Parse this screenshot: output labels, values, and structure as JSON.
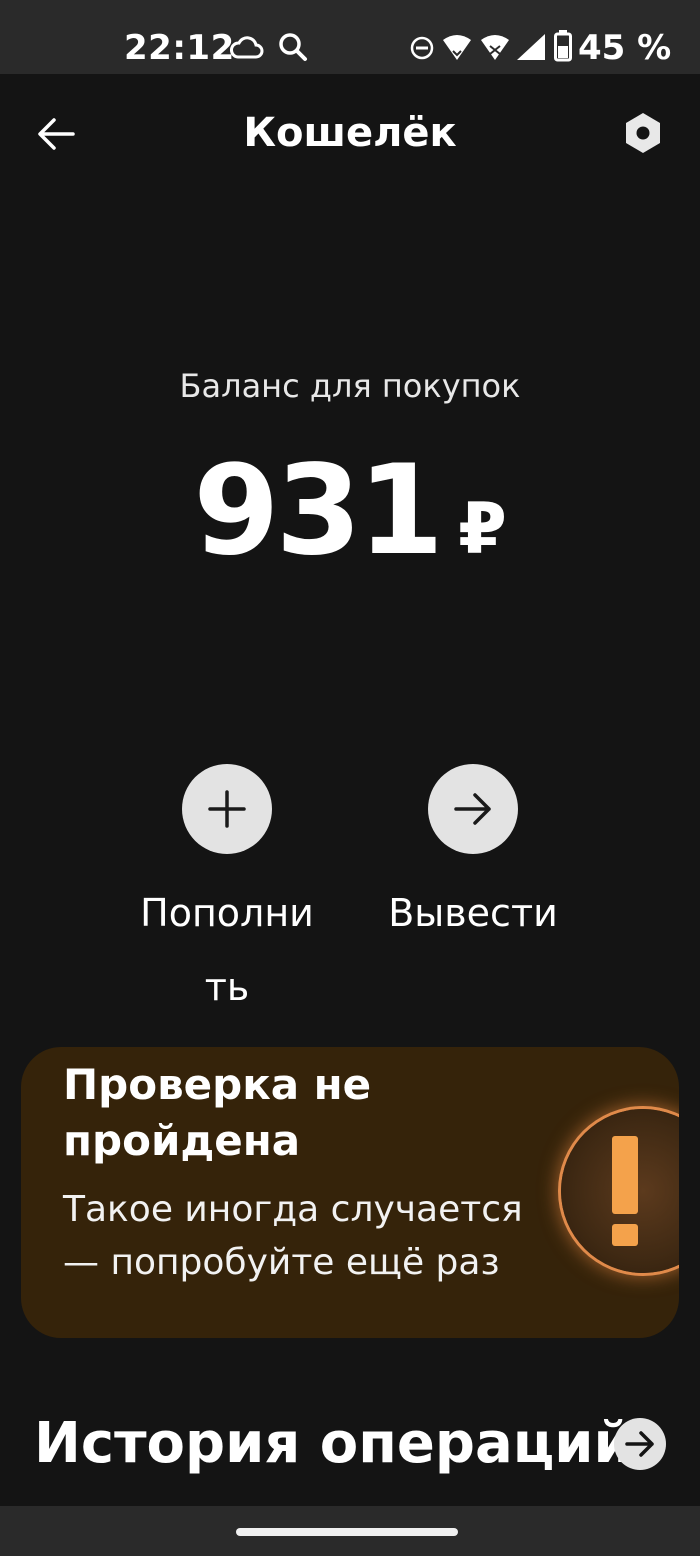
{
  "status_bar": {
    "time": "22:12",
    "battery_percent": "45 %",
    "icons": [
      "cloud-icon",
      "search-icon",
      "do-not-disturb-icon",
      "wifi-icon",
      "wifi-icon",
      "signal-icon",
      "battery-icon"
    ]
  },
  "header": {
    "title": "Кошелёк",
    "back_icon": "arrow-left-icon",
    "settings_icon": "hexagon-settings-icon"
  },
  "balance": {
    "label": "Баланс для покупок",
    "value": "931",
    "currency": "₽"
  },
  "actions": {
    "topup_label": "Пополнить",
    "withdraw_label": "Вывести"
  },
  "alert": {
    "title": "Проверка не пройдена",
    "text": "Такое иногда случается — попробуйте ещё раз",
    "accent_color": "#f4a24b",
    "background_color": "#35230a"
  },
  "history": {
    "title": "История операций"
  },
  "colors": {
    "background": "#141414",
    "bars": "#2a2a2a",
    "button_fill": "#e3e3e3"
  }
}
